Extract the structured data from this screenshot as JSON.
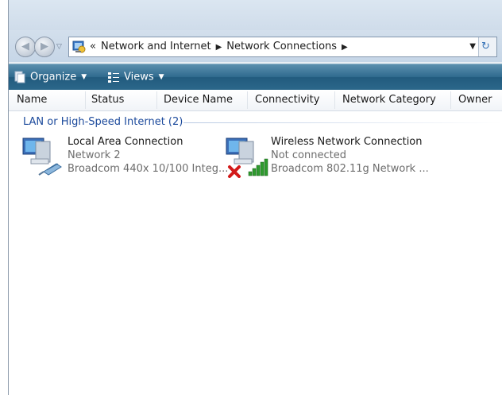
{
  "address": {
    "overflow_marker": "«",
    "crumbs": [
      "Network and Internet",
      "Network Connections"
    ]
  },
  "toolbar": {
    "organize_label": "Organize",
    "views_label": "Views"
  },
  "columns": [
    "Name",
    "Status",
    "Device Name",
    "Connectivity",
    "Network Category",
    "Owner"
  ],
  "group": {
    "label": "LAN or High-Speed Internet (2)"
  },
  "connections": [
    {
      "name": "Local Area Connection",
      "status": "Network  2",
      "device": "Broadcom 440x 10/100 Integ..."
    },
    {
      "name": "Wireless Network Connection",
      "status": "Not connected",
      "device": "Broadcom 802.11g Network ..."
    }
  ],
  "colors": {
    "toolbar": "#2f6a8e",
    "group_header": "#1c4a9c",
    "status_error": "#d21a1a",
    "signal": "#2e9b2e"
  },
  "icons": [
    "back-icon",
    "forward-icon",
    "control-panel-icon",
    "refresh-icon",
    "organize-icon",
    "views-icon",
    "network-computer-icon",
    "ethernet-cable-icon",
    "error-x-icon",
    "signal-bars-icon"
  ]
}
